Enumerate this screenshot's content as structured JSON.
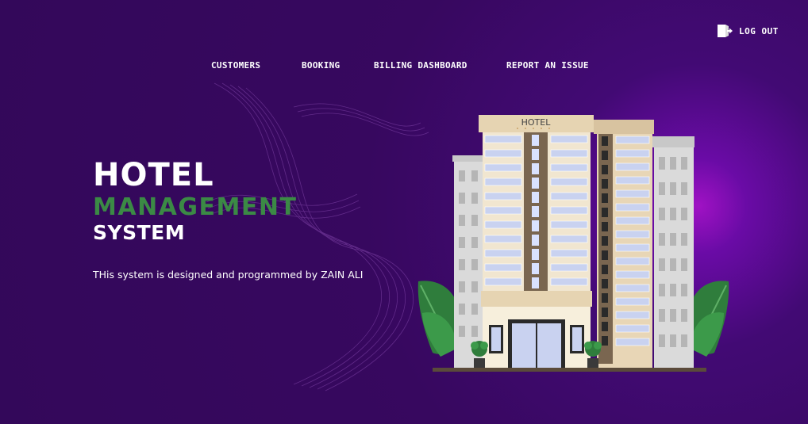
{
  "header": {
    "logout_label": "LOG OUT"
  },
  "nav": {
    "items": [
      {
        "label": "CUSTOMERS"
      },
      {
        "label": "BOOKING"
      },
      {
        "label": "BILLING DASHBOARD"
      },
      {
        "label": "REPORT AN ISSUE"
      }
    ]
  },
  "hero": {
    "line1": "HOTEL",
    "line2": "MANAGEMENT",
    "line3": "SYSTEM",
    "credit": "THis system is designed  and programmed by ZAIN ALI"
  },
  "illustration": {
    "sign_text": "HOTEL"
  },
  "colors": {
    "background": "#3a0966",
    "accent_glow": "#a012c4",
    "title_green": "#3b8a45",
    "text": "#ffffff"
  },
  "icons": {
    "logout": "logout-icon"
  }
}
